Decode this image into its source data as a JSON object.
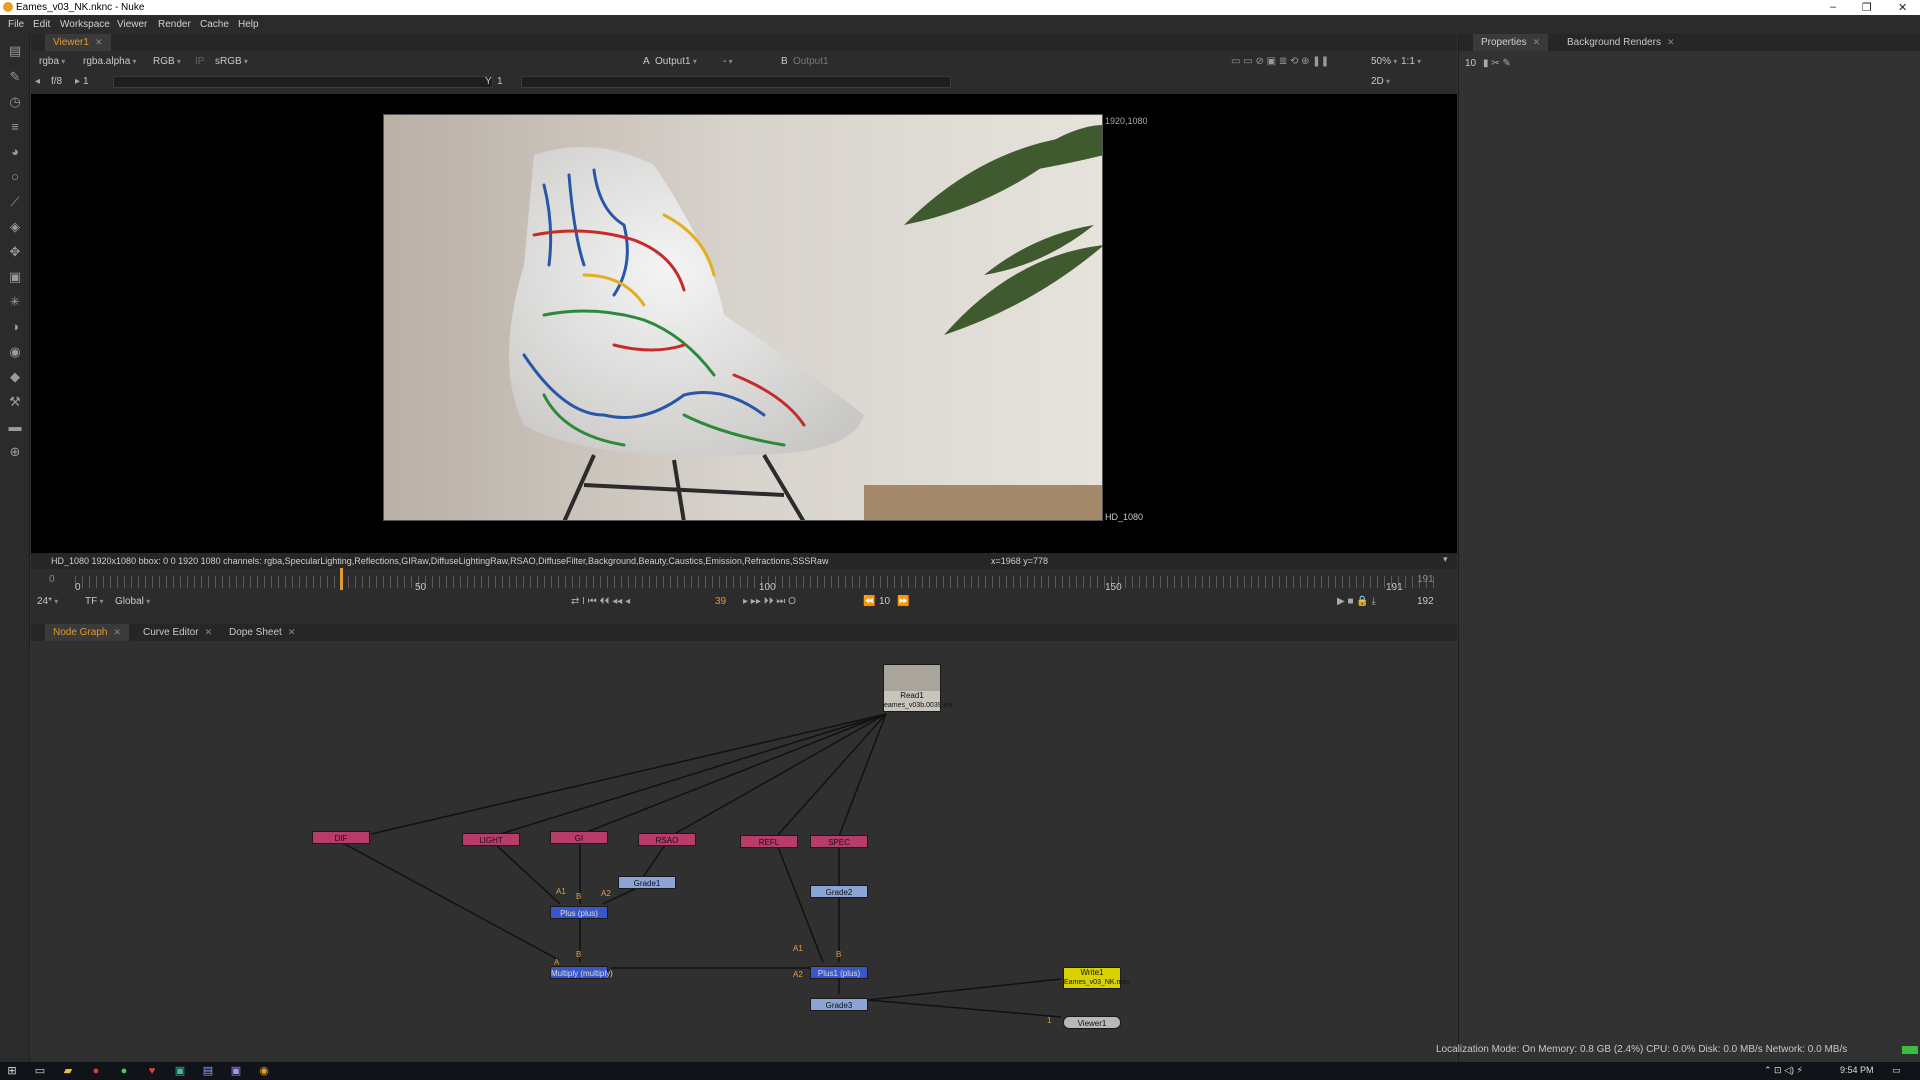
{
  "window": {
    "title": "Eames_v03_NK.nknc - Nuke"
  },
  "menu": [
    "File",
    "Edit",
    "Workspace",
    "Viewer",
    "Render",
    "Cache",
    "Help"
  ],
  "viewer": {
    "tab_label": "Viewer1",
    "channels": "rgba",
    "alpha": "rgba.alpha",
    "rgb": "RGB",
    "ip_label": "IP",
    "lut": "sRGB",
    "input_a_label": "A",
    "input_a": "Output1",
    "dash": "-",
    "input_b_label": "B",
    "input_b": "Output1",
    "zoom": "50%",
    "proxy": "1:1",
    "mode": "2D",
    "fstop": "f/8",
    "gain": "1",
    "gamma_label": "Y",
    "gamma": "1",
    "format_corner": "1920,1080",
    "format_name": "HD_1080",
    "info": "HD_1080 1920x1080  bbox: 0 0 1920 1080 channels: rgba,SpecularLighting,Reflections,GIRaw,DiffuseLightingRaw,RSAO,DiffuseFilter,Background,Beauty,Caustics,Emission,Refractions,SSSRaw",
    "coords": "x=1968 y=778"
  },
  "timeline": {
    "start": "0",
    "ticks": [
      "0",
      "50",
      "100",
      "150",
      "191"
    ],
    "end_in": "191",
    "end_out": "192",
    "current": "39",
    "fps": "24*",
    "tf": "TF",
    "global": "Global",
    "step": "10"
  },
  "node_tabs": [
    "Node Graph",
    "Curve Editor",
    "Dope Sheet"
  ],
  "nodes": {
    "read": "Read1",
    "read_file": "eames_v03b.0039.exr",
    "dif": "DIF",
    "light": "LIGHT",
    "gi": "GI",
    "rsao": "RSAO",
    "refl": "REFL",
    "spec": "SPEC",
    "grade1": "Grade1",
    "grade2": "Grade2",
    "grade3": "Grade3",
    "plus": "Plus (plus)",
    "multiply": "Multiply (multiply)",
    "plus1": "Plus1 (plus)",
    "write": "Write1",
    "write_file": "Eames_v03_NK.mov",
    "viewer": "Viewer1",
    "labels": {
      "a1": "A1",
      "b": "B",
      "a2": "A2",
      "a": "A",
      "one": "1"
    }
  },
  "properties": {
    "tab1": "Properties",
    "tab2": "Background Renders",
    "count": "10"
  },
  "status": {
    "text": "Localization Mode: On Memory: 0.8 GB (2.4%) CPU: 0.0% Disk: 0.0 MB/s Network: 0.0 MB/s"
  },
  "taskbar": {
    "time": "9:54 PM"
  },
  "colors": {
    "accent": "#e09a30",
    "read_node": "#b83c6a",
    "grade_node": "#8aa4d4",
    "merge_node": "#3a56c8",
    "write_node": "#d7d200"
  }
}
